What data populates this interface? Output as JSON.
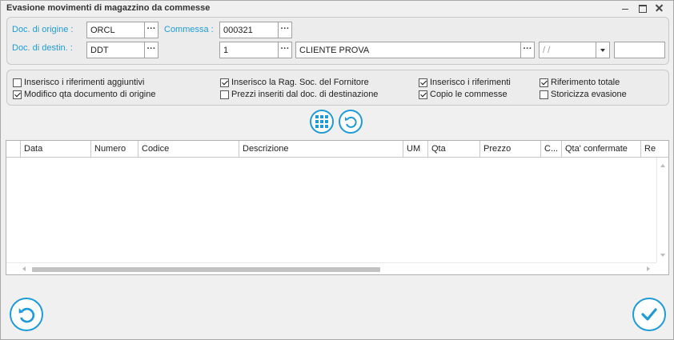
{
  "window": {
    "title": "Evasione movimenti di magazzino da commesse"
  },
  "header": {
    "doc_origine_label": "Doc. di origine :",
    "doc_origine_value": "ORCL",
    "commessa_label": "Commessa :",
    "commessa_value": "000321",
    "doc_destin_label": "Doc. di destin. :",
    "doc_destin_value": "DDT",
    "cliente_code": "1",
    "cliente_name": "CLIENTE PROVA",
    "date_value": " /  /",
    "extra_value": "",
    "ellipsis": "···"
  },
  "options": {
    "col1": [
      {
        "label": "Inserisco i riferimenti aggiuntivi",
        "checked": false
      },
      {
        "label": "Modifico qta documento di origine",
        "checked": true
      }
    ],
    "col2": [
      {
        "label": "Inserisco la Rag. Soc. del Fornitore",
        "checked": true
      },
      {
        "label": "Prezzi inseriti dal doc. di destinazione",
        "checked": false
      }
    ],
    "col3": [
      {
        "label": "Inserisco i riferimenti",
        "checked": true
      },
      {
        "label": "Copio le commesse",
        "checked": true
      }
    ],
    "col4": [
      {
        "label": "Riferimento totale",
        "checked": true
      },
      {
        "label": "Storicizza evasione",
        "checked": false
      }
    ]
  },
  "table": {
    "columns": [
      "Data",
      "Numero",
      "Codice",
      "Descrizione",
      "UM",
      "Qta",
      "Prezzo",
      "C...",
      "Qta' confermate",
      "Re"
    ],
    "rows": []
  },
  "icons": {
    "grid_button": "grid-icon",
    "refresh_button": "undo-icon",
    "back_button": "undo-icon",
    "confirm_button": "check-icon"
  },
  "colors": {
    "accent": "#1e9bd7"
  }
}
